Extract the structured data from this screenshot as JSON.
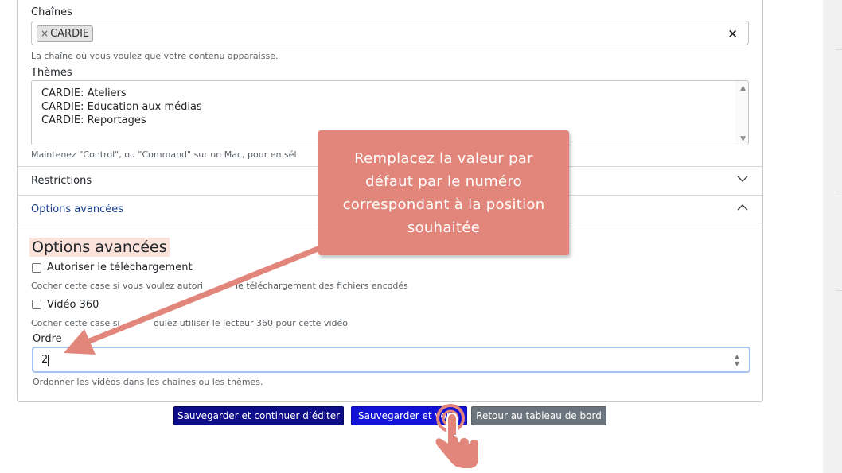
{
  "form": {
    "chains_label": "Chaînes",
    "chain_tag": "CARDIE",
    "chain_tag_remove": "×",
    "chain_clear": "×",
    "chains_help": "La chaîne où vous voulez que votre contenu apparaisse.",
    "themes_label": "Thèmes",
    "themes_options": [
      "CARDIE: Ateliers",
      "CARDIE: Education aux médias",
      "CARDIE: Reportages"
    ],
    "themes_help": "Maintenez \"Control\", ou \"Command\" sur un Mac, pour en sél"
  },
  "accordion": {
    "restrictions_label": "Restrictions",
    "advanced_label": "Options avancées"
  },
  "advanced": {
    "heading": "Options avancées",
    "download_label": "Autoriser le téléchargement",
    "download_help_a": "Cocher cette case si vous voulez autori",
    "download_help_b": "le téléchargement des fichiers encodés",
    "video360_label": "Vidéo 360",
    "video360_help_a": "Cocher cette case si",
    "video360_help_b": "oulez utiliser le lecteur 360 pour cette vidéo",
    "order_label": "Ordre",
    "order_value": "2",
    "order_help": "Ordonner les vidéos dans les chaines ou les thèmes."
  },
  "buttons": {
    "save_continue": "Sauvegarder et continuer d’éditer",
    "save_view": "Sauvegarder et voir",
    "back_dashboard": "Retour au tableau de bord"
  },
  "tooltip": {
    "lines": [
      "Remplacez la valeur par",
      "défaut par le numéro",
      "correspondant à la position",
      "souhaitée"
    ]
  },
  "colors": {
    "tooltip_bg": "#e2857a",
    "highlight": "#fbe3dc",
    "btn_dark": "#0d0d8a",
    "btn_blue": "#1313d6",
    "btn_gray": "#6c757d",
    "accent_link": "#1a3e8c"
  },
  "icons": {
    "restrictions_chevron": "chevron-down-icon",
    "advanced_chevron": "chevron-up-icon",
    "spinner": "number-spinner-icon",
    "cursor": "hand-pointer-icon"
  }
}
